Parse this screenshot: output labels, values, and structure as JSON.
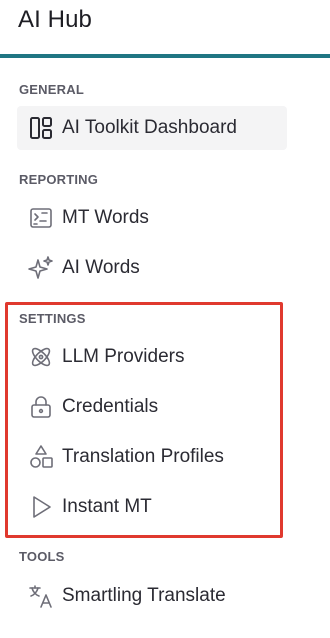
{
  "header": {
    "title": "AI Hub",
    "accent_color": "#1f7683"
  },
  "sections": {
    "general": {
      "label": "GENERAL",
      "items": [
        {
          "label": "AI Toolkit Dashboard",
          "icon": "dashboard-icon",
          "active": true
        }
      ]
    },
    "reporting": {
      "label": "REPORTING",
      "items": [
        {
          "label": "MT Words",
          "icon": "mt-words-icon"
        },
        {
          "label": "AI Words",
          "icon": "sparkles-icon"
        }
      ]
    },
    "settings": {
      "label": "SETTINGS",
      "items": [
        {
          "label": "LLM Providers",
          "icon": "atom-icon"
        },
        {
          "label": "Credentials",
          "icon": "lock-icon"
        },
        {
          "label": "Translation Profiles",
          "icon": "shapes-icon"
        },
        {
          "label": "Instant MT",
          "icon": "play-icon"
        }
      ]
    },
    "tools": {
      "label": "TOOLS",
      "items": [
        {
          "label": "Smartling Translate",
          "icon": "translate-icon"
        }
      ]
    }
  },
  "highlight": {
    "color": "#e0392e",
    "target": "settings"
  }
}
